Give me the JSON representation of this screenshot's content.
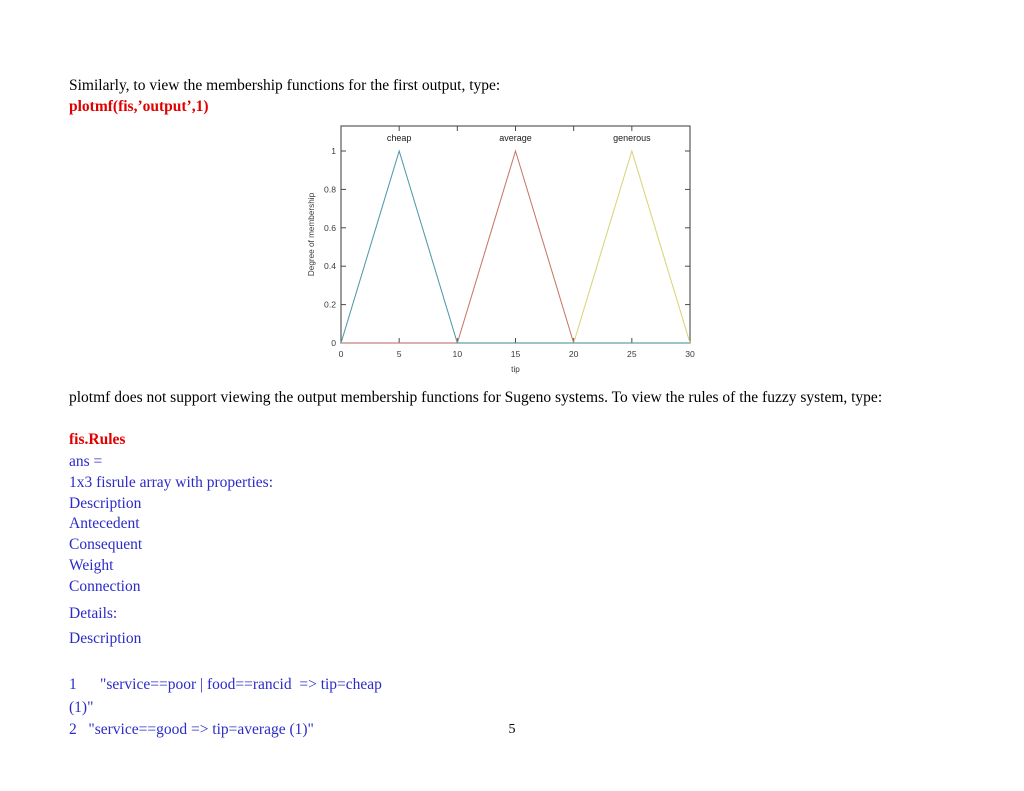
{
  "document": {
    "page_number": "5",
    "intro_line": "Similarly, to view the membership functions for the first output, type:",
    "command_1": "plotmf(fis,’output’,1)",
    "paragraph_2": "plotmf does not support viewing the output membership functions for Sugeno systems. To view the rules of the fuzzy system, type:",
    "command_2": "fis.Rules",
    "ans_block": "ans =\n1x3 fisrule array with properties:\nDescription\nAntecedent\nConsequent\nWeight\nConnection",
    "details_label": "Details:",
    "description_label": "Description",
    "rules_block": "1      \"service==poor | food==rancid  => tip=cheap\n(1)\"\n2   \"service==good => tip=average (1)\""
  },
  "colors": {
    "body_text": "#000000",
    "command_red": "#e00000",
    "output_blue": "#2b2bc8",
    "axis_gray": "#4a4a4a",
    "series_cheap": "#4f9aa8",
    "series_average": "#c8766b",
    "series_generous": "#d8d47a"
  },
  "chart_data": {
    "type": "line",
    "title": "",
    "xlabel": "tip",
    "ylabel": "Degree of membership",
    "xlim": [
      0,
      30
    ],
    "ylim": [
      0,
      1.05
    ],
    "xticks": [
      0,
      5,
      10,
      15,
      20,
      25,
      30
    ],
    "xticklabels": [
      "0",
      "5",
      "10",
      "15",
      "20",
      "25",
      "30"
    ],
    "yticks": [
      0,
      0.2,
      0.4,
      0.6,
      0.8,
      1
    ],
    "yticklabels": [
      "0",
      "0.2",
      "0.4",
      "0.6",
      "0.8",
      "1"
    ],
    "grid": false,
    "legend_position": "in-plot-top-labels",
    "annotations": [
      {
        "text": "cheap",
        "x": 5,
        "y": 1.05
      },
      {
        "text": "average",
        "x": 15,
        "y": 1.05
      },
      {
        "text": "generous",
        "x": 25,
        "y": 1.05
      }
    ],
    "series": [
      {
        "name": "cheap",
        "color": "#4f9aa8",
        "x": [
          0,
          5,
          10,
          30
        ],
        "values": [
          0,
          1,
          0,
          0
        ]
      },
      {
        "name": "average",
        "color": "#c8766b",
        "x": [
          0,
          10,
          15,
          20,
          30
        ],
        "values": [
          0,
          0,
          1,
          0,
          0
        ]
      },
      {
        "name": "generous",
        "color": "#d8d47a",
        "x": [
          0,
          20,
          25,
          30
        ],
        "values": [
          0,
          0,
          1,
          0
        ]
      }
    ]
  }
}
